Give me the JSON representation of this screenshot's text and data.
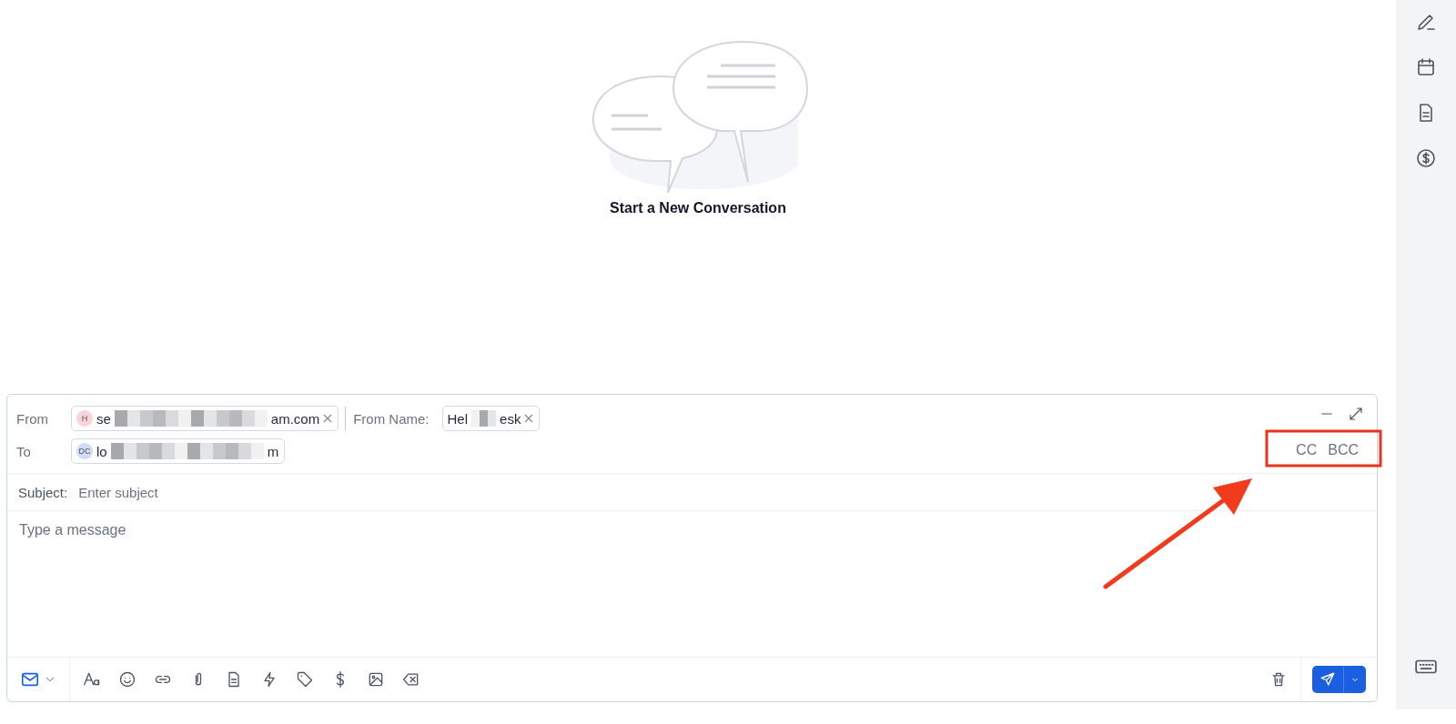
{
  "empty_state": {
    "caption": "Start a New Conversation"
  },
  "composer": {
    "from": {
      "label": "From",
      "chip": {
        "avatar": "H",
        "color": "#f9d3da",
        "text_start": "se",
        "text_end": "am.com"
      }
    },
    "from_name": {
      "label": "From Name:",
      "chip": {
        "text_start": "Hel",
        "text_end": "esk"
      }
    },
    "to": {
      "label": "To",
      "chip": {
        "avatar": "DC",
        "color": "#cfdcf7",
        "text_start": "lo",
        "text_end": "m"
      }
    },
    "recipient_links": [
      "CC",
      "BCC"
    ],
    "subject": {
      "label": "Subject:",
      "placeholder": "Enter subject"
    },
    "message": {
      "placeholder": "Type a message"
    }
  }
}
